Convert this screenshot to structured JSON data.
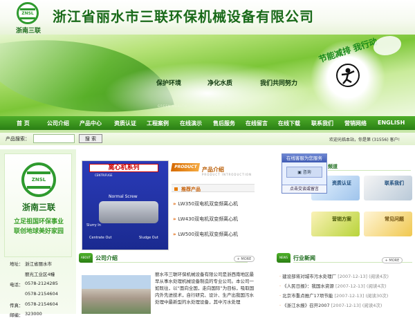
{
  "header": {
    "logo_en": "ZNSL",
    "logo_cn": "浙南三联",
    "company_name": "浙江省丽水市三联环保机械设备有限公司"
  },
  "banner": {
    "sub_left": "GREEN HEALTH",
    "sub_mid": "HEALTH FOR ALL",
    "slogan_1": "保护环境",
    "slogan_2": "净化水质",
    "slogan_3": "我们共同努力",
    "badge_text": "节能减排 我行动"
  },
  "nav": {
    "items": [
      "首 页",
      "公司介绍",
      "产品中心",
      "资质认证",
      "工程案例",
      "在线演示",
      "售后服务",
      "在线留言",
      "在线下载",
      "联系我们",
      "营销网络",
      "ENGLISH"
    ]
  },
  "search": {
    "label": "产品搜索：",
    "button": "搜 索",
    "welcome": "欢迎光临本站，你是第 (31556) 客户!"
  },
  "left": {
    "logo_en": "ZNSL",
    "logo_cn": "浙南三联",
    "motto_1": "立足祖国环保事业",
    "motto_2": "联创地球美好家园",
    "address_label": "地址：",
    "address_1": "浙江省丽水市",
    "address_2": "丽光工业区4幢",
    "phone_label": "电话：",
    "phone_1": "0578-2124285",
    "phone_2": "0578-2154604",
    "phone_3": "0578-2159188",
    "fax_label": "传真：",
    "fax": "0578-2154604",
    "zip_label": "邮编：",
    "zip": "323000"
  },
  "products": {
    "image_title": "离心机系列",
    "image_sub": "CENTRIFUGE",
    "image_label": "Normal Screw",
    "image_in": "Slurry In",
    "image_out1": "Centrate Out",
    "image_out2": "Sludge Out",
    "tag": "PRODUCT",
    "title": "产品介绍",
    "subtitle": "PRODUCT INTRODUCTION",
    "recommend": "推荐产品",
    "list": [
      "LW350双电机双变频离心机",
      "LW430双电机双变频离心机",
      "LW500双电机双变频离心机"
    ]
  },
  "about": {
    "tag": "ABOUT",
    "title": "公司介绍",
    "more": "+ MORE",
    "text": "丽水市三联环保机械设备有限公司是浙西南地区最早从事水处理机械设备制造的专业公司。本公司一如既往，以“面向全国，走向国际”为目标，吸取国内外先进技术，自行研究、设计、生产出我国污水处理中最新型的水处理设备，其中污水处理"
  },
  "service": {
    "header": "在线客服为您服务",
    "consult": "咨询",
    "leave_msg": "点击交谈或留言"
  },
  "channels": {
    "title": "频道",
    "tiles": [
      "资质认证",
      "联系我们",
      "营销方案",
      "常见问题"
    ]
  },
  "news": {
    "tag": "NEWS",
    "title": "行业新闻",
    "more": "+ MORE",
    "items": [
      {
        "title": "建设部将对城市污水处理厂",
        "date": "[2007-12-13]",
        "views": "(阅读4次)"
      },
      {
        "title": "《人民日报》：我国水资源",
        "date": "[2007-12-13]",
        "views": "(阅读4次)"
      },
      {
        "title": "北京市重点推广17项节能",
        "date": "[2007-12-13]",
        "views": "(阅读30次)"
      },
      {
        "title": "《浙江水报》召开2007",
        "date": "[2007-12-13]",
        "views": "(阅读4次)"
      }
    ]
  }
}
